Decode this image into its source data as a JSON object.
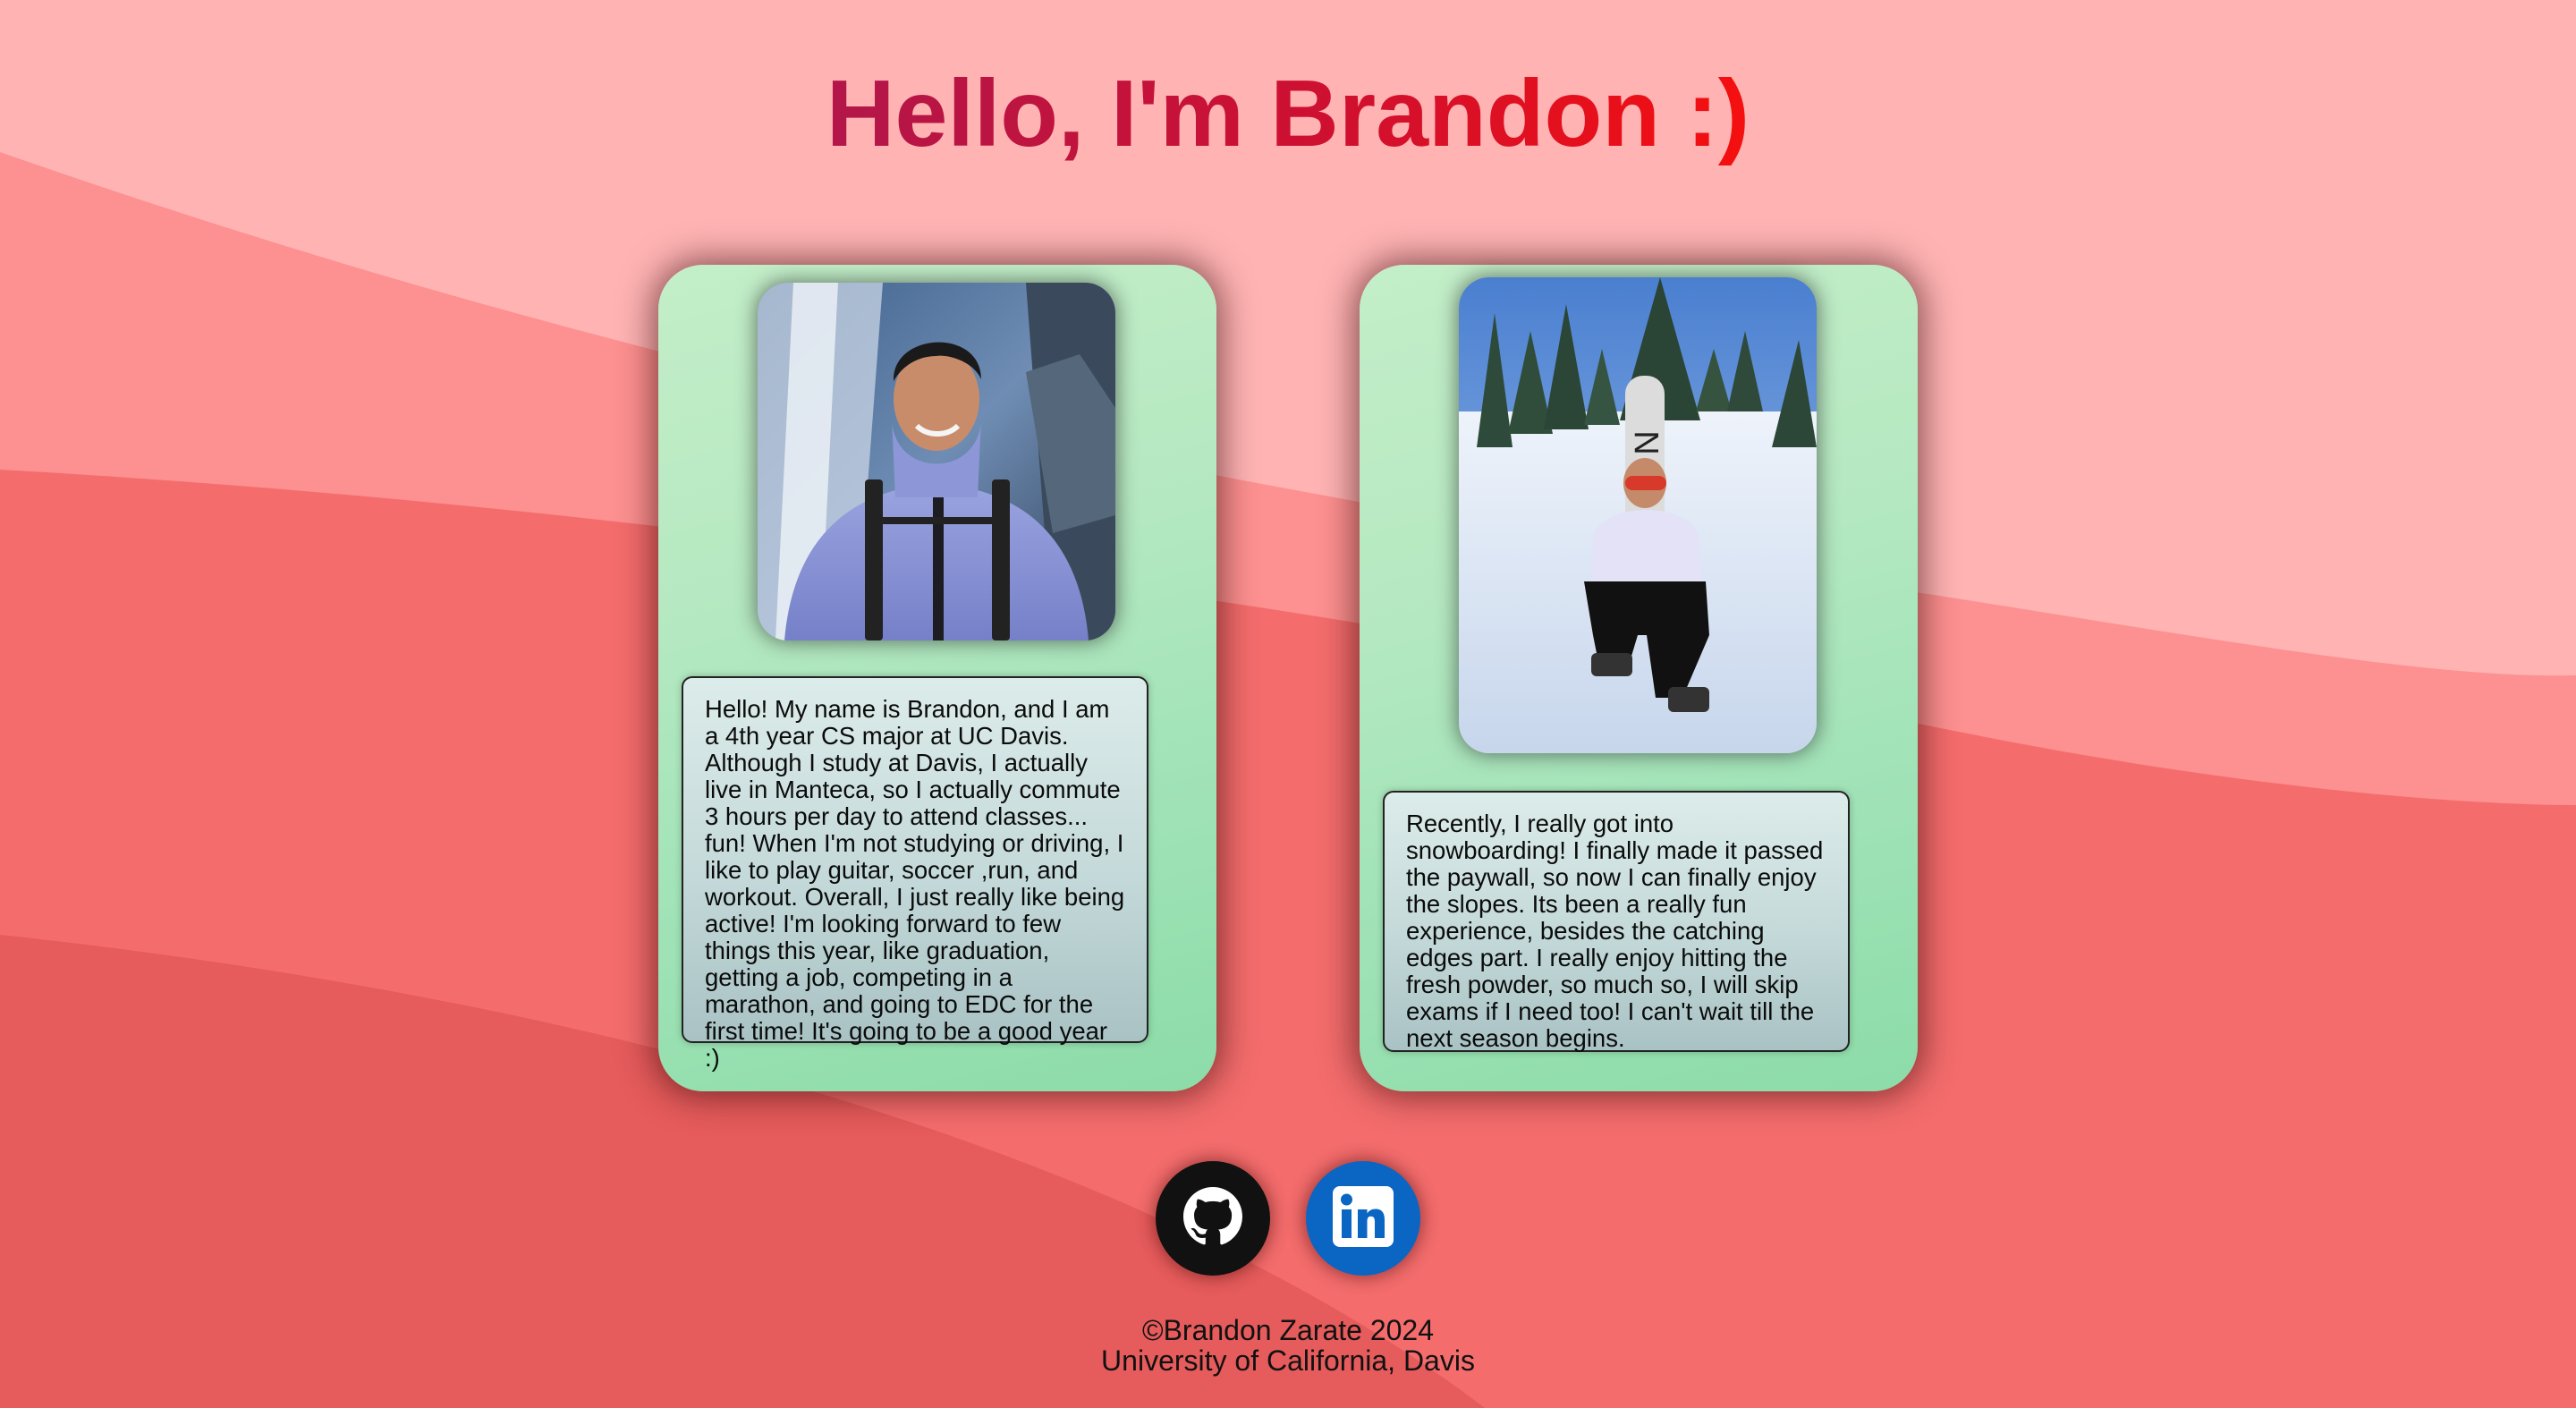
{
  "header": {
    "title": "Hello, I'm Brandon :)"
  },
  "cards": [
    {
      "photo_description": "portrait-waterfall",
      "text": "Hello! My name is Brandon, and I am a 4th year CS major at UC Davis. Although I study at Davis, I actually live in Manteca, so I actually commute 3 hours per day to attend classes... fun! When I'm not studying or driving, I like to play guitar, soccer ,run, and workout. Overall, I just really like being active! I'm looking forward to few things this year, like graduation, getting a job, competing in a marathon, and going to EDC for the first time! It's going to be a good year :)"
    },
    {
      "photo_description": "snowboarding-snow",
      "text": "Recently, I really got into snowboarding! I finally made it passed the paywall, so now I can finally enjoy the slopes. Its been a really fun experience, besides the catching edges part. I really enjoy hitting the fresh powder, so much so, I will skip exams if I need too! I can't wait till the next season begins."
    }
  ],
  "social": {
    "github_icon": "github-icon",
    "linkedin_icon": "linkedin-icon",
    "github_color": "#111111",
    "linkedin_color": "#0a66c2"
  },
  "footer": {
    "copyright": "©Brandon Zarate 2024",
    "school": "University of California, Davis"
  },
  "colors": {
    "background_light": "#ffb3b3",
    "background_mid": "#fb8a8a",
    "background_dark": "#e65d5d",
    "card_green": "#a8e4b9",
    "title_gradient_start": "#b3164a",
    "title_gradient_end": "#f50f0f"
  }
}
